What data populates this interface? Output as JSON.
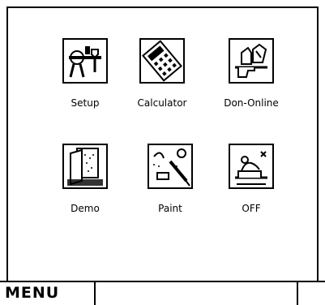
{
  "apps": [
    {
      "label": "Setup",
      "icon": "setup-tools-icon"
    },
    {
      "label": "Calculator",
      "icon": "calculator-icon"
    },
    {
      "label": "Don-Online",
      "icon": "online-hand-icon"
    },
    {
      "label": "Demo",
      "icon": "demo-door-icon"
    },
    {
      "label": "Paint",
      "icon": "paint-brush-icon"
    },
    {
      "label": "OFF",
      "icon": "off-person-icon"
    }
  ],
  "menubar": {
    "label": "MENU",
    "field_value": ""
  }
}
